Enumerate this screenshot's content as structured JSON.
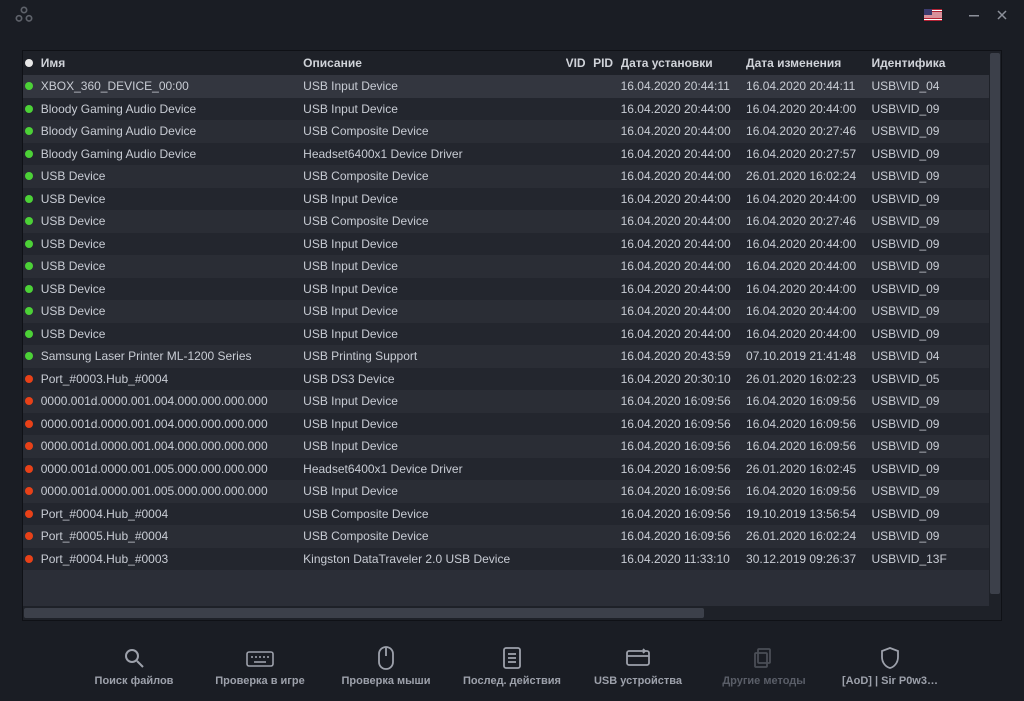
{
  "locale_flag": "en-US",
  "table": {
    "headers": {
      "name": "Имя",
      "desc": "Описание",
      "vid": "VID",
      "pid": "PID",
      "installed": "Дата установки",
      "modified": "Дата изменения",
      "id": "Идентифика"
    },
    "rows": [
      {
        "status": "green",
        "name": "XBOX_360_DEVICE_00:00",
        "desc": "USB Input Device",
        "vid": "",
        "pid": "",
        "installed": "16.04.2020 20:44:11",
        "modified": "16.04.2020 20:44:11",
        "id": "USB\\VID_04"
      },
      {
        "status": "green",
        "name": "Bloody Gaming Audio Device",
        "desc": "USB Input Device",
        "vid": "",
        "pid": "",
        "installed": "16.04.2020 20:44:00",
        "modified": "16.04.2020 20:44:00",
        "id": "USB\\VID_09"
      },
      {
        "status": "green",
        "name": "Bloody Gaming Audio Device",
        "desc": "USB Composite Device",
        "vid": "",
        "pid": "",
        "installed": "16.04.2020 20:44:00",
        "modified": "16.04.2020 20:27:46",
        "id": "USB\\VID_09"
      },
      {
        "status": "green",
        "name": "Bloody Gaming Audio Device",
        "desc": "Headset6400x1 Device Driver",
        "vid": "",
        "pid": "",
        "installed": "16.04.2020 20:44:00",
        "modified": "16.04.2020 20:27:57",
        "id": "USB\\VID_09"
      },
      {
        "status": "green",
        "name": "USB Device",
        "desc": "USB Composite Device",
        "vid": "",
        "pid": "",
        "installed": "16.04.2020 20:44:00",
        "modified": "26.01.2020 16:02:24",
        "id": "USB\\VID_09"
      },
      {
        "status": "green",
        "name": "USB Device",
        "desc": "USB Input Device",
        "vid": "",
        "pid": "",
        "installed": "16.04.2020 20:44:00",
        "modified": "16.04.2020 20:44:00",
        "id": "USB\\VID_09"
      },
      {
        "status": "green",
        "name": "USB Device",
        "desc": "USB Composite Device",
        "vid": "",
        "pid": "",
        "installed": "16.04.2020 20:44:00",
        "modified": "16.04.2020 20:27:46",
        "id": "USB\\VID_09"
      },
      {
        "status": "green",
        "name": "USB Device",
        "desc": "USB Input Device",
        "vid": "",
        "pid": "",
        "installed": "16.04.2020 20:44:00",
        "modified": "16.04.2020 20:44:00",
        "id": "USB\\VID_09"
      },
      {
        "status": "green",
        "name": "USB Device",
        "desc": "USB Input Device",
        "vid": "",
        "pid": "",
        "installed": "16.04.2020 20:44:00",
        "modified": "16.04.2020 20:44:00",
        "id": "USB\\VID_09"
      },
      {
        "status": "green",
        "name": "USB Device",
        "desc": "USB Input Device",
        "vid": "",
        "pid": "",
        "installed": "16.04.2020 20:44:00",
        "modified": "16.04.2020 20:44:00",
        "id": "USB\\VID_09"
      },
      {
        "status": "green",
        "name": "USB Device",
        "desc": "USB Input Device",
        "vid": "",
        "pid": "",
        "installed": "16.04.2020 20:44:00",
        "modified": "16.04.2020 20:44:00",
        "id": "USB\\VID_09"
      },
      {
        "status": "green",
        "name": "USB Device",
        "desc": "USB Input Device",
        "vid": "",
        "pid": "",
        "installed": "16.04.2020 20:44:00",
        "modified": "16.04.2020 20:44:00",
        "id": "USB\\VID_09"
      },
      {
        "status": "green",
        "name": "Samsung Laser Printer ML-1200 Series",
        "desc": "USB Printing Support",
        "vid": "",
        "pid": "",
        "installed": "16.04.2020 20:43:59",
        "modified": "07.10.2019 21:41:48",
        "id": "USB\\VID_04"
      },
      {
        "status": "red",
        "name": "Port_#0003.Hub_#0004",
        "desc": "USB DS3 Device",
        "vid": "",
        "pid": "",
        "installed": "16.04.2020 20:30:10",
        "modified": "26.01.2020 16:02:23",
        "id": "USB\\VID_05"
      },
      {
        "status": "red",
        "name": "0000.001d.0000.001.004.000.000.000.000",
        "desc": "USB Input Device",
        "vid": "",
        "pid": "",
        "installed": "16.04.2020 16:09:56",
        "modified": "16.04.2020 16:09:56",
        "id": "USB\\VID_09"
      },
      {
        "status": "red",
        "name": "0000.001d.0000.001.004.000.000.000.000",
        "desc": "USB Input Device",
        "vid": "",
        "pid": "",
        "installed": "16.04.2020 16:09:56",
        "modified": "16.04.2020 16:09:56",
        "id": "USB\\VID_09"
      },
      {
        "status": "red",
        "name": "0000.001d.0000.001.004.000.000.000.000",
        "desc": "USB Input Device",
        "vid": "",
        "pid": "",
        "installed": "16.04.2020 16:09:56",
        "modified": "16.04.2020 16:09:56",
        "id": "USB\\VID_09"
      },
      {
        "status": "red",
        "name": "0000.001d.0000.001.005.000.000.000.000",
        "desc": "Headset6400x1 Device Driver",
        "vid": "",
        "pid": "",
        "installed": "16.04.2020 16:09:56",
        "modified": "26.01.2020 16:02:45",
        "id": "USB\\VID_09"
      },
      {
        "status": "red",
        "name": "0000.001d.0000.001.005.000.000.000.000",
        "desc": "USB Input Device",
        "vid": "",
        "pid": "",
        "installed": "16.04.2020 16:09:56",
        "modified": "16.04.2020 16:09:56",
        "id": "USB\\VID_09"
      },
      {
        "status": "red",
        "name": "Port_#0004.Hub_#0004",
        "desc": "USB Composite Device",
        "vid": "",
        "pid": "",
        "installed": "16.04.2020 16:09:56",
        "modified": "19.10.2019 13:56:54",
        "id": "USB\\VID_09"
      },
      {
        "status": "red",
        "name": "Port_#0005.Hub_#0004",
        "desc": "USB Composite Device",
        "vid": "",
        "pid": "",
        "installed": "16.04.2020 16:09:56",
        "modified": "26.01.2020 16:02:24",
        "id": "USB\\VID_09"
      },
      {
        "status": "red",
        "name": "Port_#0004.Hub_#0003",
        "desc": "Kingston DataTraveler 2.0 USB Device",
        "vid": "",
        "pid": "",
        "installed": "16.04.2020 11:33:10",
        "modified": "30.12.2019 09:26:37",
        "id": "USB\\VID_13F"
      }
    ]
  },
  "nav": [
    {
      "key": "search-files",
      "label": "Поиск файлов",
      "icon": "search"
    },
    {
      "key": "ingame-check",
      "label": "Проверка в игре",
      "icon": "keyboard"
    },
    {
      "key": "mouse-check",
      "label": "Проверка мыши",
      "icon": "mouse"
    },
    {
      "key": "last-actions",
      "label": "Послед. действия",
      "icon": "list"
    },
    {
      "key": "usb-devices",
      "label": "USB устройства",
      "icon": "usb"
    },
    {
      "key": "other-methods",
      "label": "Другие методы",
      "icon": "stack",
      "dim": true
    },
    {
      "key": "user",
      "label": "[AoD] | Sir P0w3…",
      "icon": "shield"
    }
  ]
}
